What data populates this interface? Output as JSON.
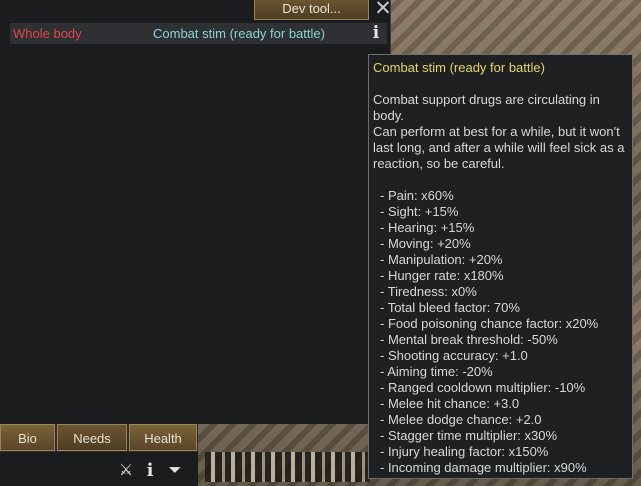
{
  "panel": {
    "dev_tool_label": "Dev tool...",
    "close_glyph": "✕",
    "row": {
      "body_part": "Whole body",
      "hediff": "Combat stim (ready for battle)",
      "info_glyph": "i"
    }
  },
  "tooltip": {
    "title": "Combat stim (ready for battle)",
    "description": "Combat support drugs are circulating in body.\nCan perform at best for a while, but it won't last long, and after a while will feel sick as a reaction, so be careful.",
    "stats": [
      "- Pain: x60%",
      "- Sight: +15%",
      "- Hearing: +15%",
      "- Moving: +20%",
      "- Manipulation: +20%",
      "- Hunger rate: x180%",
      "- Tiredness: x0%",
      "- Total bleed factor: 70%",
      "- Food poisoning chance factor: x20%",
      "- Mental break threshold: -50%",
      "- Shooting accuracy: +1.0",
      "- Aiming time: -20%",
      "- Ranged cooldown multiplier: -10%",
      "- Melee hit chance: +3.0",
      "- Melee dodge chance: +2.0",
      "- Stagger time multiplier: x30%",
      "- Injury healing factor: x150%",
      "- Incoming damage multiplier: x90%"
    ]
  },
  "tabs": {
    "bio": "Bio",
    "needs": "Needs",
    "health": "Health"
  },
  "bottom_icons": {
    "draft": "draft-icon",
    "info": "info-icon",
    "more": "chevron-down-icon"
  },
  "colors": {
    "body_part": "#e0464a",
    "hediff": "#8ad3d3",
    "tooltip_title": "#e8d55a"
  }
}
